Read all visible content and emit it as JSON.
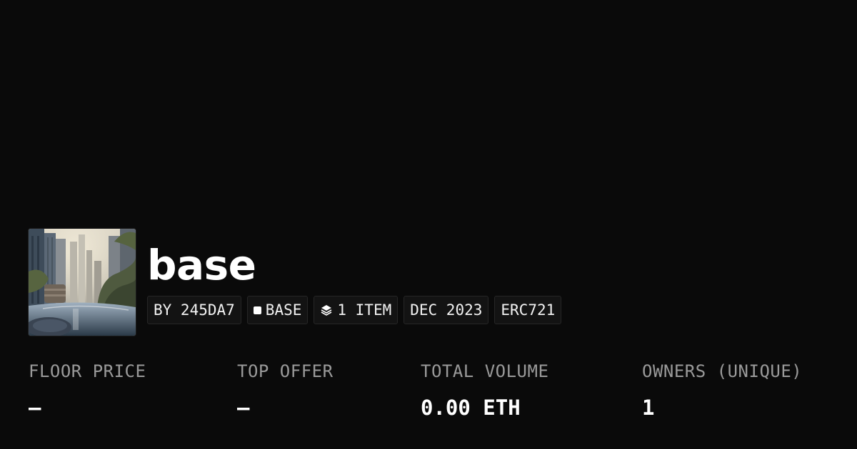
{
  "collection": {
    "name": "base",
    "image_alt": "city-garden-artwork"
  },
  "tags": {
    "creator": "BY 245DA7",
    "chain": "BASE",
    "items": "1 ITEM",
    "date": "DEC 2023",
    "standard": "ERC721"
  },
  "stats": {
    "floor_price": {
      "label": "FLOOR PRICE",
      "value": "–"
    },
    "top_offer": {
      "label": "TOP OFFER",
      "value": "–"
    },
    "total_volume": {
      "label": "TOTAL VOLUME",
      "value": "0.00 ETH"
    },
    "owners": {
      "label": "OWNERS (UNIQUE)",
      "value": "1"
    }
  },
  "colors": {
    "background": "#0a0a0a",
    "tag_background": "#131313",
    "tag_border": "#262626",
    "label_gray": "#9a9a9a",
    "text": "#ffffff"
  },
  "icons": {
    "chain": "square-dot-icon",
    "items": "layers-icon"
  }
}
